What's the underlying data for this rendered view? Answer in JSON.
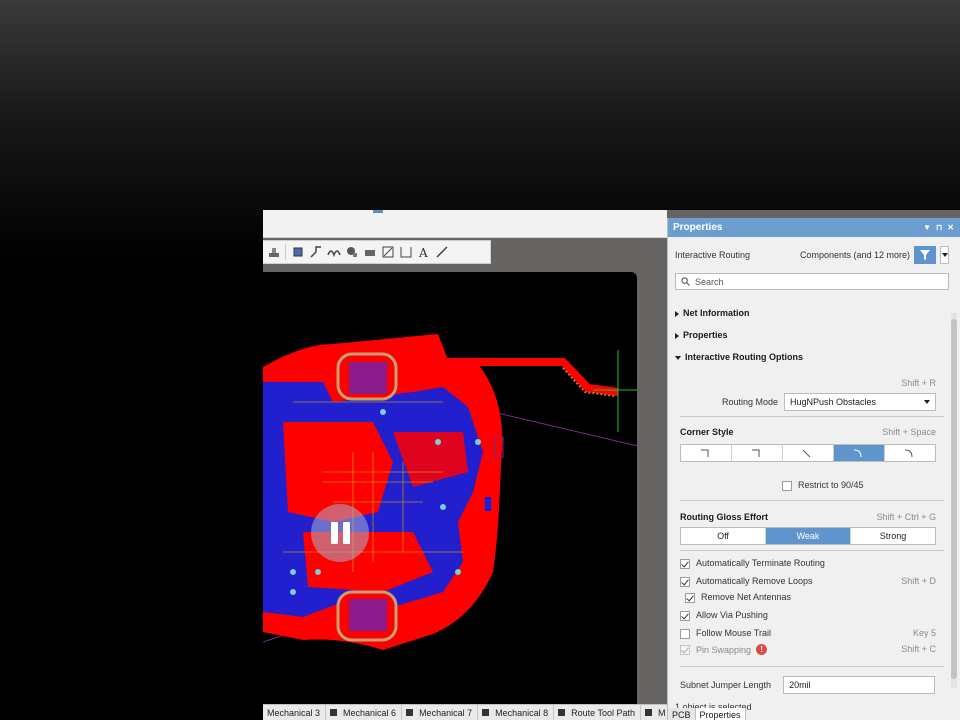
{
  "panel": {
    "title": "Properties",
    "header_left": "Interactive Routing",
    "header_right": "Components (and 12 more)",
    "search_placeholder": "Search",
    "sections": {
      "net_info": "Net Information",
      "properties": "Properties",
      "iro": "Interactive Routing Options"
    },
    "routing_mode_shortcut": "Shift + R",
    "routing_mode_label": "Routing Mode",
    "routing_mode_value": "HugNPush Obstacles",
    "corner_style_label": "Corner Style",
    "corner_style_shortcut": "Shift + Space",
    "corner_style_selected_index": 3,
    "restrict_label": "Restrict to 90/45",
    "gloss_label": "Routing Gloss Effort",
    "gloss_shortcut": "Shift + Ctrl + G",
    "gloss_options": [
      "Off",
      "Weak",
      "Strong"
    ],
    "gloss_selected": "Weak",
    "checks": [
      {
        "label": "Automatically Terminate Routing",
        "shortcut": "",
        "checked": true
      },
      {
        "label": "Automatically Remove Loops",
        "shortcut": "Shift + D",
        "checked": true
      },
      {
        "label": "Remove Net Antennas",
        "shortcut": "",
        "checked": true
      },
      {
        "label": "Allow Via Pushing",
        "shortcut": "",
        "checked": true
      },
      {
        "label": "Follow Mouse Trail",
        "shortcut": "Key 5",
        "checked": false
      },
      {
        "label": "Pin Swapping",
        "shortcut": "Shift + C",
        "checked": true
      }
    ],
    "subnet_label": "Subnet Jumper Length",
    "subnet_value": "20mil",
    "status": "1 object is selected",
    "bottom_tabs": [
      "PCB",
      "Properties"
    ]
  },
  "layer_tabs": [
    "Mechanical 3",
    "Mechanical 6",
    "Mechanical 7",
    "Mechanical 8",
    "Route Tool Path",
    "M"
  ],
  "colors": {
    "accent": "#5f95cc",
    "title_bar": "#6c9fd0",
    "board_top": "#ff0000",
    "board_bottom": "#0a22e6",
    "component": "#8b1a8b"
  }
}
